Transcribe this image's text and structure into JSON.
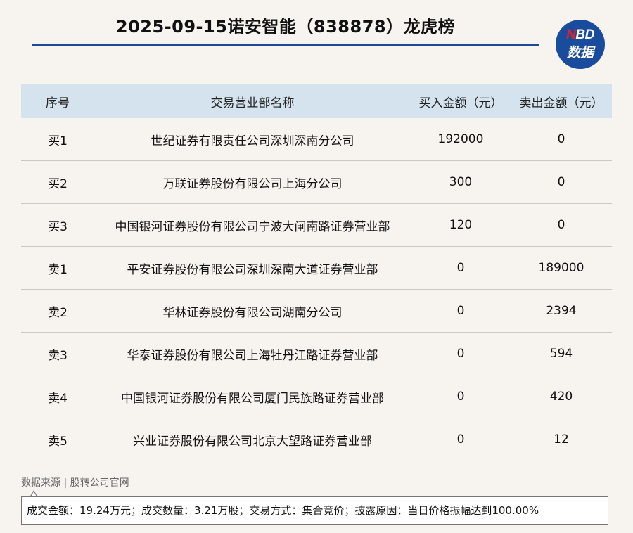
{
  "title": "2025-09-15诺安智能（838878）龙虎榜",
  "logo": {
    "top_n": "N",
    "top_rest": "BD",
    "bottom": "数据"
  },
  "table": {
    "headers": [
      "序号",
      "交易营业部名称",
      "买入金额（元）",
      "卖出金额（元）"
    ],
    "rows": [
      [
        "买1",
        "世纪证券有限责任公司深圳深南分公司",
        "192000",
        "0"
      ],
      [
        "买2",
        "万联证券股份有限公司上海分公司",
        "300",
        "0"
      ],
      [
        "买3",
        "中国银河证券股份有限公司宁波大闸南路证券营业部",
        "120",
        "0"
      ],
      [
        "卖1",
        "平安证券股份有限公司深圳深南大道证券营业部",
        "0",
        "189000"
      ],
      [
        "卖2",
        "华林证券股份有限公司湖南分公司",
        "0",
        "2394"
      ],
      [
        "卖3",
        "华泰证券股份有限公司上海牡丹江路证券营业部",
        "0",
        "594"
      ],
      [
        "卖4",
        "中国银河证券股份有限公司厦门民族路证券营业部",
        "0",
        "420"
      ],
      [
        "卖5",
        "兴业证券股份有限公司北京大望路证券营业部",
        "0",
        "12"
      ]
    ]
  },
  "source": "数据来源 | 股转公司官网",
  "note": "成交金额：19.24万元；成交数量：3.21万股；交易方式：集合竞价；披露原因：当日价格振幅达到100.00%",
  "colors": {
    "accent": "#1d4a93",
    "header_bg": "#d5e3ee",
    "logo_red": "#e0202a",
    "background": "#f7f4ef"
  }
}
